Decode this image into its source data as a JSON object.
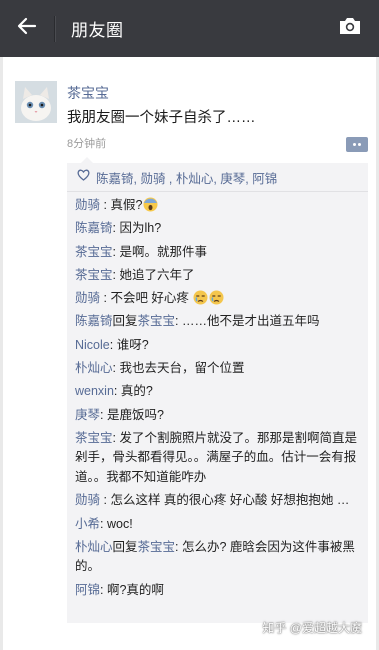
{
  "header": {
    "title": "朋友圈",
    "back_icon": "back-arrow-icon",
    "camera_icon": "camera-icon",
    "bar_color": "#393a3f"
  },
  "post": {
    "author": "茶宝宝",
    "text": "我朋友圈一个妹子自杀了……",
    "time": "8分钟前",
    "more_icon": "comment-more-icon"
  },
  "likes": {
    "icon": "heart-icon",
    "names": "陈嘉锜, 勋骑 , 朴灿心, 庚琴, 阿锦"
  },
  "comments": [
    {
      "name": "勋骑",
      "sep": " : ",
      "text": "真假?",
      "emoji": "scream"
    },
    {
      "name": "陈嘉锜",
      "sep": ": ",
      "text": "因为lh?"
    },
    {
      "name": "茶宝宝",
      "sep": ": ",
      "text": "是啊。就那件事"
    },
    {
      "name": "茶宝宝",
      "sep": ": ",
      "text": "她追了六年了"
    },
    {
      "name": "勋骑",
      "sep": " : ",
      "text": "不会吧 好心疼 ",
      "emoji": "sad2"
    },
    {
      "name": "陈嘉锜",
      "reply": "回复",
      "reply_to": "茶宝宝",
      "sep": ": ",
      "text": "……他不是才出道五年吗"
    },
    {
      "name": "Nicole",
      "sep": ": ",
      "text": "谁呀?"
    },
    {
      "name": "朴灿心",
      "sep": ": ",
      "text": "我也去天台，留个位置"
    },
    {
      "name": "wenxin",
      "sep": ": ",
      "text": "真的?"
    },
    {
      "name": "庚琴",
      "sep": ": ",
      "text": "是鹿饭吗?"
    },
    {
      "name": "茶宝宝",
      "sep": ": ",
      "text": "发了个割腕照片就没了。那那是割啊简直是剁手，骨头都看得见。。满屋子的血。估计一会有报道。。我都不知道能咋办"
    },
    {
      "name": "勋骑",
      "sep": " : ",
      "text": "怎么这样 真的很心疼 好心酸 好想抱抱她 …"
    },
    {
      "name": "小希",
      "sep": ": ",
      "text": "woc!"
    },
    {
      "name": "朴灿心",
      "reply": "回复",
      "reply_to": "茶宝宝",
      "sep": ": ",
      "text": "怎么办? 鹿晗会因为这件事被黑的。"
    },
    {
      "name": "阿锦",
      "sep": ": ",
      "text": "啊?真的啊"
    }
  ],
  "watermark": "知乎 @爱超越大魔",
  "colors": {
    "name_blue": "#576b95",
    "comment_bg": "#f3f3f5"
  }
}
